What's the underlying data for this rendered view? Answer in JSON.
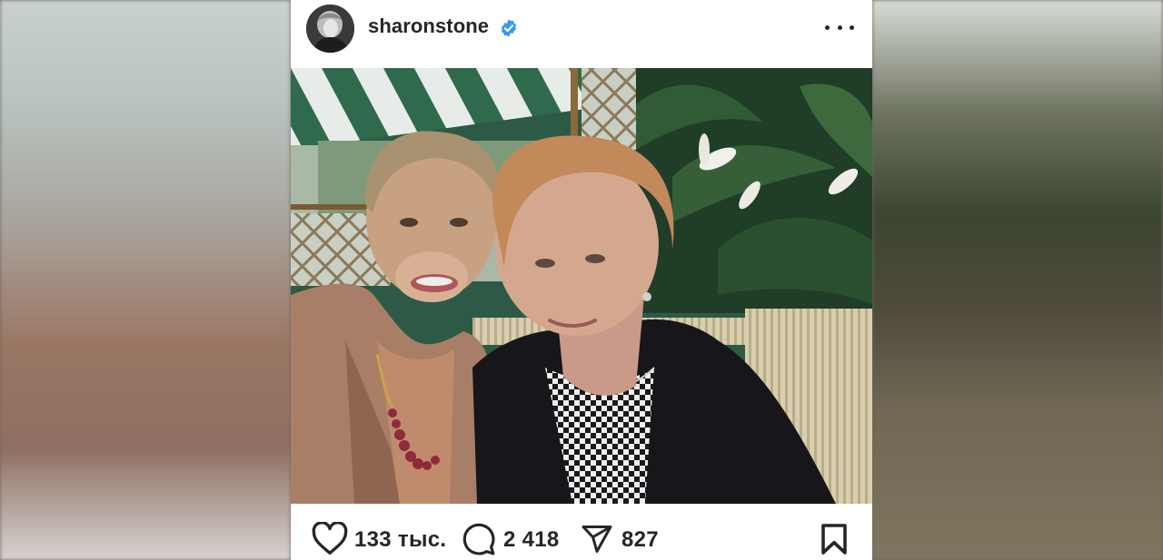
{
  "post": {
    "username": "sharonstone",
    "verified": true,
    "likes": "133 тыс.",
    "comments": "2 418",
    "shares": "827"
  },
  "icons": {
    "verified": "verified-badge-icon",
    "more": "more-options-icon",
    "like": "heart-icon",
    "comment": "comment-icon",
    "share": "send-icon",
    "save": "bookmark-icon"
  },
  "colors": {
    "verified": "#3897f0",
    "text": "#262626"
  }
}
